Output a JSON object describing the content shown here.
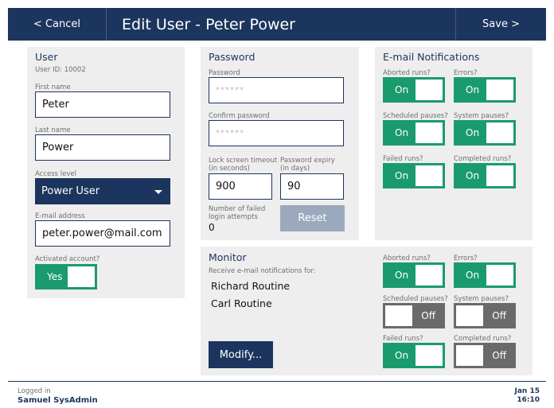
{
  "header": {
    "cancel_label": "< Cancel",
    "title": "Edit User - Peter Power",
    "save_label": "Save >"
  },
  "user": {
    "section_title": "User",
    "user_id": "User ID: 10002",
    "first_name_label": "First name",
    "first_name": "Peter",
    "last_name_label": "Last name",
    "last_name": "Power",
    "access_level_label": "Access level",
    "access_level": "Power User",
    "email_label": "E-mail address",
    "email": "peter.power@mail.com",
    "activated_label": "Activated account?",
    "activated": "Yes"
  },
  "password": {
    "section_title": "Password",
    "password_label": "Password",
    "password_value": "******",
    "confirm_label": "Confirm password",
    "confirm_value": "******",
    "lock_timeout_label_1": "Lock screen timeout",
    "lock_timeout_label_2": "(in seconds)",
    "lock_timeout": "900",
    "expiry_label_1": "Password expiry",
    "expiry_label_2": "(in days)",
    "expiry": "90",
    "failed_label_1": "Number of failed",
    "failed_label_2": "login attempts",
    "failed_value": "0",
    "reset_label": "Reset"
  },
  "email_notifications": {
    "section_title": "E-mail Notifications",
    "aborted_label": "Aborted runs?",
    "aborted": "On",
    "errors_label": "Errors?",
    "errors": "On",
    "scheduled_label": "Scheduled pauses?",
    "scheduled": "On",
    "system_label": "System pauses?",
    "system": "On",
    "failed_label": "Failed runs?",
    "failed": "On",
    "completed_label": "Completed runs?",
    "completed": "On"
  },
  "monitor": {
    "section_title": "Monitor",
    "subtitle": "Receive e-mail notifications for:",
    "users": [
      "Richard Routine",
      "Carl Routine"
    ],
    "modify_label": "Modify...",
    "aborted_label": "Aborted runs?",
    "aborted": "On",
    "errors_label": "Errors?",
    "errors": "On",
    "scheduled_label": "Scheduled pauses?",
    "scheduled": "Off",
    "system_label": "System pauses?",
    "system": "Off",
    "failed_label": "Failed runs?",
    "failed": "On",
    "completed_label": "Completed runs?",
    "completed": "Off"
  },
  "footer": {
    "logged_in_label": "Logged in",
    "user_name": "Samuel SysAdmin",
    "date": "Jan 15",
    "time": "16:10"
  },
  "colors": {
    "header_bg": "#1c355e",
    "toggle_on": "#1a9b6e",
    "toggle_off": "#6a6a6a",
    "panel_bg": "#eeeeee",
    "reset_disabled": "#9aa9bd"
  }
}
